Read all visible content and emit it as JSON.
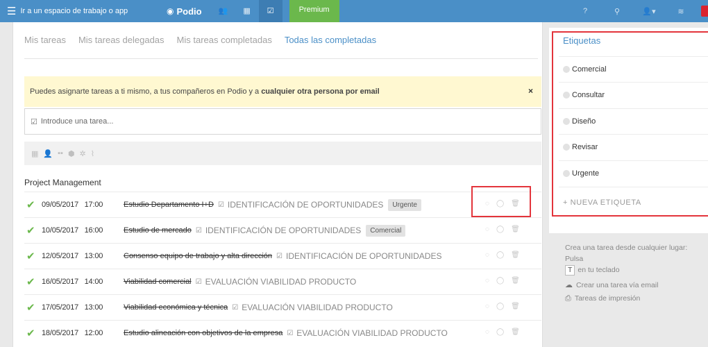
{
  "topbar": {
    "workspace_label": "Ir a un espacio de trabajo o app",
    "logo_text": "Podio",
    "premium_label": "Premium",
    "help_icon_text": "?"
  },
  "tabs": [
    {
      "label": "Mis tareas",
      "active": false
    },
    {
      "label": "Mis tareas delegadas",
      "active": false
    },
    {
      "label": "Mis tareas completadas",
      "active": false
    },
    {
      "label": "Todas las completadas",
      "active": true
    }
  ],
  "info_banner": {
    "text": "Puedes asignarte tareas a ti mismo, a tus compañeros en Podio y a",
    "bold_text": "cualquier otra persona por email",
    "close_symbol": "×"
  },
  "task_input": {
    "placeholder": "Introduce una tarea..."
  },
  "section_title": "Project Management",
  "tasks": [
    {
      "date": "09/05/2017",
      "time": "17:00",
      "title": "Estudio Departamento I+D",
      "ref": "IDENTIFICACIÓN DE OPORTUNIDADES",
      "tag": "Urgente"
    },
    {
      "date": "10/05/2017",
      "time": "16:00",
      "title": "Estudio de mercado",
      "ref": "IDENTIFICACIÓN DE OPORTUNIDADES",
      "tag": "Comercial"
    },
    {
      "date": "12/05/2017",
      "time": "13:00",
      "title": "Consenso equipo de trabajo y alta dirección",
      "ref": "IDENTIFICACIÓN DE OPORTUNIDADES",
      "tag": ""
    },
    {
      "date": "16/05/2017",
      "time": "14:00",
      "title": "Viabilidad comercial",
      "ref": "EVALUACIÓN VIABILIDAD PRODUCTO",
      "tag": ""
    },
    {
      "date": "17/05/2017",
      "time": "13:00",
      "title": "Viabilidad económica y técnica",
      "ref": "EVALUACIÓN VIABILIDAD PRODUCTO",
      "tag": ""
    },
    {
      "date": "18/05/2017",
      "time": "12:00",
      "title": "Estudio alineación con objetivos de la empresa",
      "ref": "EVALUACIÓN VIABILIDAD PRODUCTO",
      "tag": ""
    }
  ],
  "sidebar": {
    "title": "Etiquetas",
    "labels": [
      "Comercial",
      "Consultar",
      "Diseño",
      "Revisar",
      "Urgente"
    ],
    "new_label": "+ NUEVA ETIQUETA"
  },
  "help": {
    "text_before": "Crea una tarea desde cualquier lugar: Pulsa",
    "key": "T",
    "text_after": "en tu teclado",
    "email_link": "Crear una tarea vía email",
    "print_link": "Tareas de impresión"
  },
  "colors": {
    "topbar": "#4a8fc7",
    "premium": "#6bb84c",
    "accent": "#4a8fc7",
    "done_check": "#6bb84c",
    "highlight_box": "#e3343b",
    "banner_bg": "#fff8d1"
  }
}
